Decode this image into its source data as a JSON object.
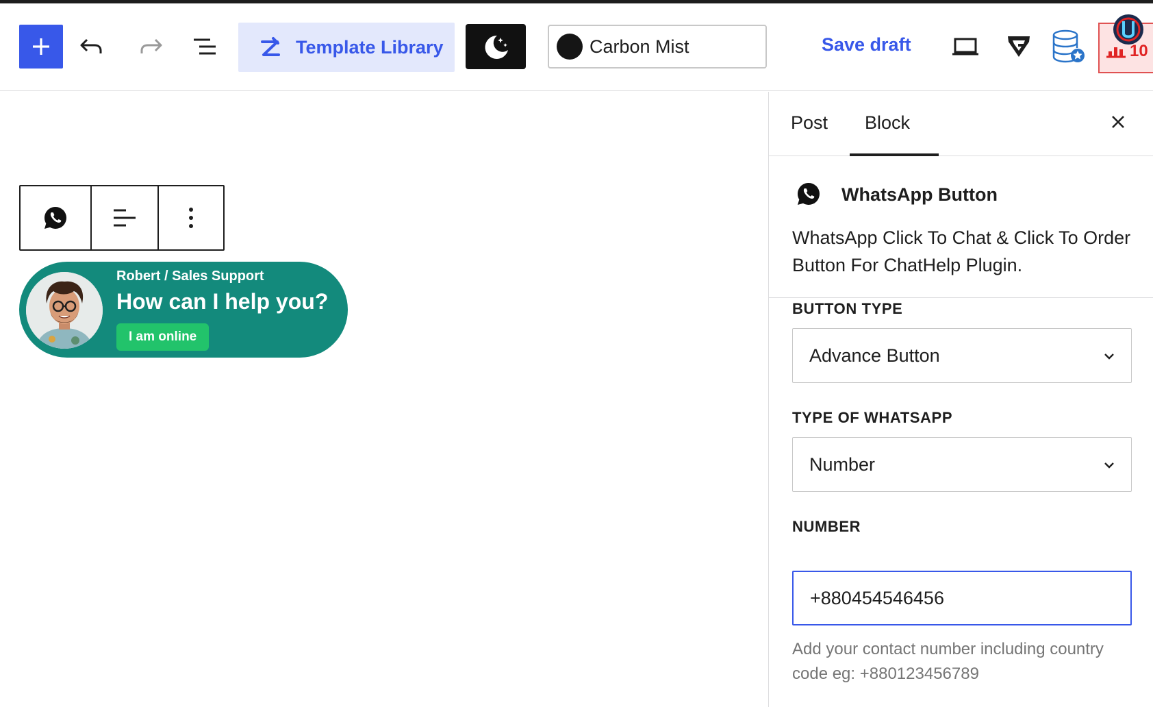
{
  "toolbar": {
    "add_icon": "plus-icon",
    "undo_icon": "undo-icon",
    "redo_icon": "redo-icon",
    "list_view_icon": "list-view-icon",
    "template_library_label": "Template Library",
    "template_library_icon": "template-library-icon",
    "dark_mode_icon": "moon-icon",
    "theme_name": "Carbon Mist",
    "theme_color": "#151515",
    "save_label": "Save draft",
    "preview_icon": "laptop-icon",
    "shield_icon": "g-shield-icon",
    "database_icon": "database-star-icon",
    "extension_badge_count": "10"
  },
  "canvas": {
    "block_toolbar": {
      "icons": [
        "whatsapp-icon",
        "align-left-icon",
        "more-vertical-icon"
      ]
    },
    "whatsapp_widget": {
      "name": "Robert / Sales Support",
      "title": "How can I help you?",
      "status": "I am online",
      "bg_color": "#138a7c",
      "status_color": "#22c36b"
    }
  },
  "sidebar": {
    "tabs": [
      {
        "label": "Post",
        "active": false
      },
      {
        "label": "Block",
        "active": true
      }
    ],
    "block": {
      "title": "WhatsApp Button",
      "description": "WhatsApp Click To Chat & Click To Order Button For ChatHelp Plugin."
    },
    "fields": {
      "button_type": {
        "label": "BUTTON TYPE",
        "value": "Advance Button"
      },
      "whatsapp_type": {
        "label": "TYPE OF WHATSAPP",
        "value": "Number"
      },
      "number": {
        "label": "NUMBER",
        "value": "+880454546456"
      },
      "help": "Add your contact number including country code eg: +880123456789"
    }
  },
  "colors": {
    "accent": "#3858e9",
    "accent_light": "#e3e8fc",
    "text": "#1e1e1e",
    "muted": "#757575"
  }
}
